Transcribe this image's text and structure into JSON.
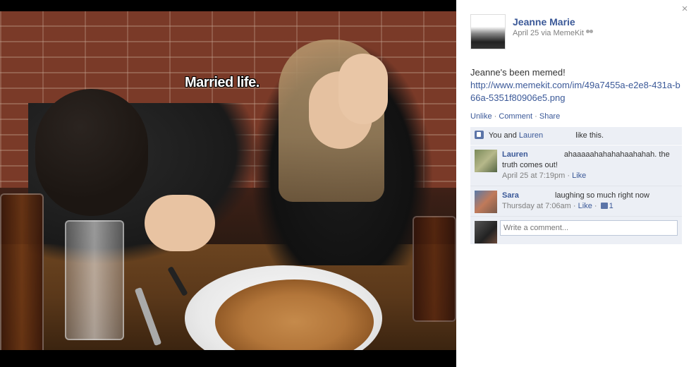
{
  "photo": {
    "caption": "Married life."
  },
  "post": {
    "author_name": "Jeanne Marie",
    "date_via": "April 25 via MemeKit",
    "body_text": "Jeanne's been memed!",
    "link": "http://www.memekit.com/im/49a7455a-e2e8-431a-b66a-5351f80906e5.png",
    "actions": {
      "unlike": "Unlike",
      "comment": "Comment",
      "share": "Share",
      "sep": "·"
    }
  },
  "likes": {
    "you_and": "You and",
    "friend": "Lauren",
    "suffix": "like this."
  },
  "comments": [
    {
      "author": "Lauren",
      "text": "ahaaaaahahahahaahahah. the truth comes out!",
      "time": "April 25 at 7:19pm",
      "like_label": "Like"
    },
    {
      "author": "Sara",
      "text": "laughing so much right now",
      "time": "Thursday at 7:06am",
      "like_label": "Like",
      "like_count": "1"
    }
  ],
  "write_comment": {
    "placeholder": "Write a comment..."
  },
  "close_symbol": "×",
  "icons": [
    "close-icon",
    "friends-audience-icon",
    "like-thumb-icon"
  ],
  "colors": {
    "link_blue": "#3b5998",
    "feedback_bg": "#eceff5",
    "meta_gray": "#808080"
  }
}
